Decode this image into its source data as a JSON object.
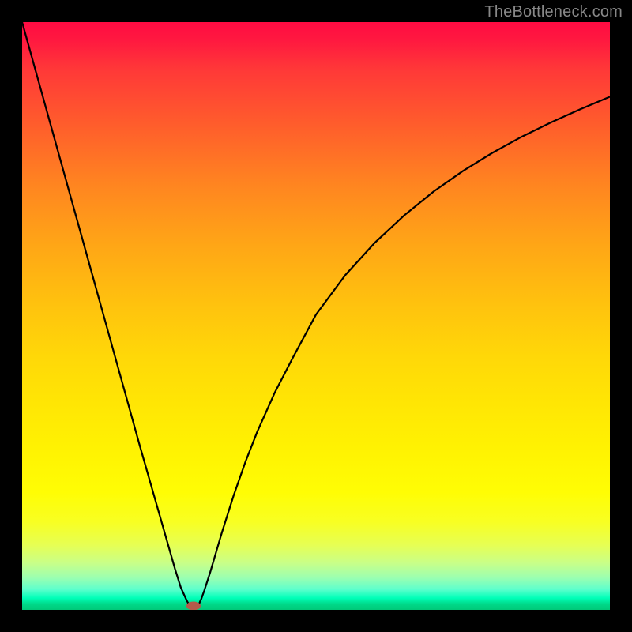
{
  "watermark": "TheBottleneck.com",
  "chart_data": {
    "type": "line",
    "title": "",
    "xlabel": "",
    "ylabel": "",
    "ylim": [
      0,
      100
    ],
    "xlim": [
      0,
      100
    ],
    "x": [
      0,
      5,
      10,
      15,
      20,
      22,
      24,
      26,
      27,
      28,
      28.5,
      29,
      29.5,
      30,
      30.5,
      31,
      32,
      33,
      34,
      36,
      38,
      40,
      43,
      46,
      50,
      55,
      60,
      65,
      70,
      75,
      80,
      85,
      90,
      95,
      100
    ],
    "y": [
      100,
      82,
      64,
      46,
      28,
      21,
      14,
      7,
      3.8,
      1.6,
      0.7,
      0.2,
      0.2,
      0.8,
      1.9,
      3.3,
      6.4,
      9.8,
      13.2,
      19.5,
      25.2,
      30.3,
      37.0,
      42.8,
      49.3,
      55.9,
      61.2,
      65.7,
      69.4,
      72.5,
      75.2,
      77.5,
      79.4,
      81.0,
      82.4
    ],
    "annotations": [
      {
        "type": "marker",
        "label": "min-dot",
        "x": 29,
        "y": 0
      }
    ]
  },
  "colors": {
    "curve": "#000000",
    "marker": "#b55a4a",
    "frame": "#000000"
  }
}
